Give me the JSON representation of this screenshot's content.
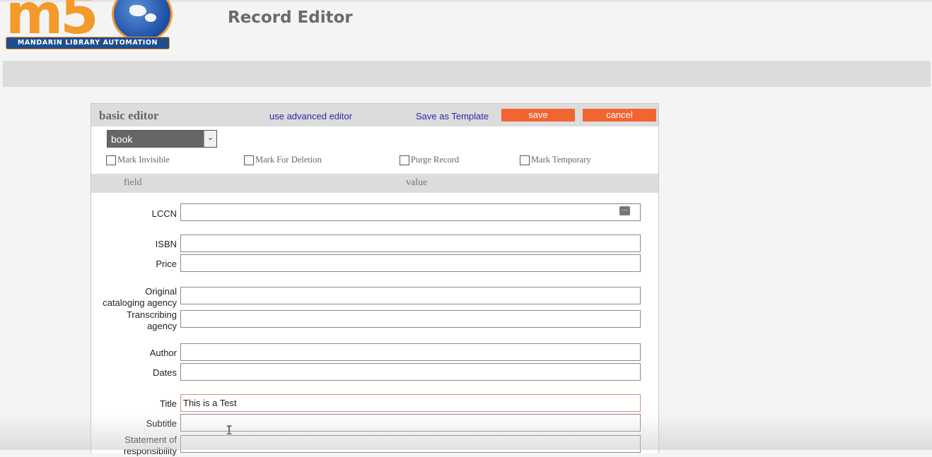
{
  "app": {
    "logo_text": "m5",
    "logo_tagline": "MANDARIN LIBRARY AUTOMATION",
    "page_title": "Record Editor",
    "brand_color": "#f39a2a",
    "accent_color": "#f26430"
  },
  "editor": {
    "title": "basic editor",
    "advanced_link": "use advanced editor",
    "template_link": "Save as Template",
    "save_label": "save",
    "cancel_label": "cancel",
    "material_type": "book",
    "checkboxes": [
      {
        "label": "Mark Invisible",
        "checked": false
      },
      {
        "label": "Mark For Deletion",
        "checked": false
      },
      {
        "label": "Purge Record",
        "checked": false
      },
      {
        "label": "Mark Temporary",
        "checked": false
      }
    ],
    "columns": {
      "field": "field",
      "value": "value"
    },
    "fields": [
      {
        "label": "LCCN",
        "value": ""
      },
      {
        "label": "ISBN",
        "value": ""
      },
      {
        "label": "Price",
        "value": ""
      },
      {
        "label": "Original\ncataloging agency",
        "value": ""
      },
      {
        "label": "Transcribing\nagency",
        "value": ""
      },
      {
        "label": "Author",
        "value": ""
      },
      {
        "label": "Dates",
        "value": ""
      },
      {
        "label": "Title",
        "value": "This is a Test"
      },
      {
        "label": "Subtitle",
        "value": ""
      },
      {
        "label": "Statement of\nresponsibility",
        "value": ""
      }
    ]
  }
}
